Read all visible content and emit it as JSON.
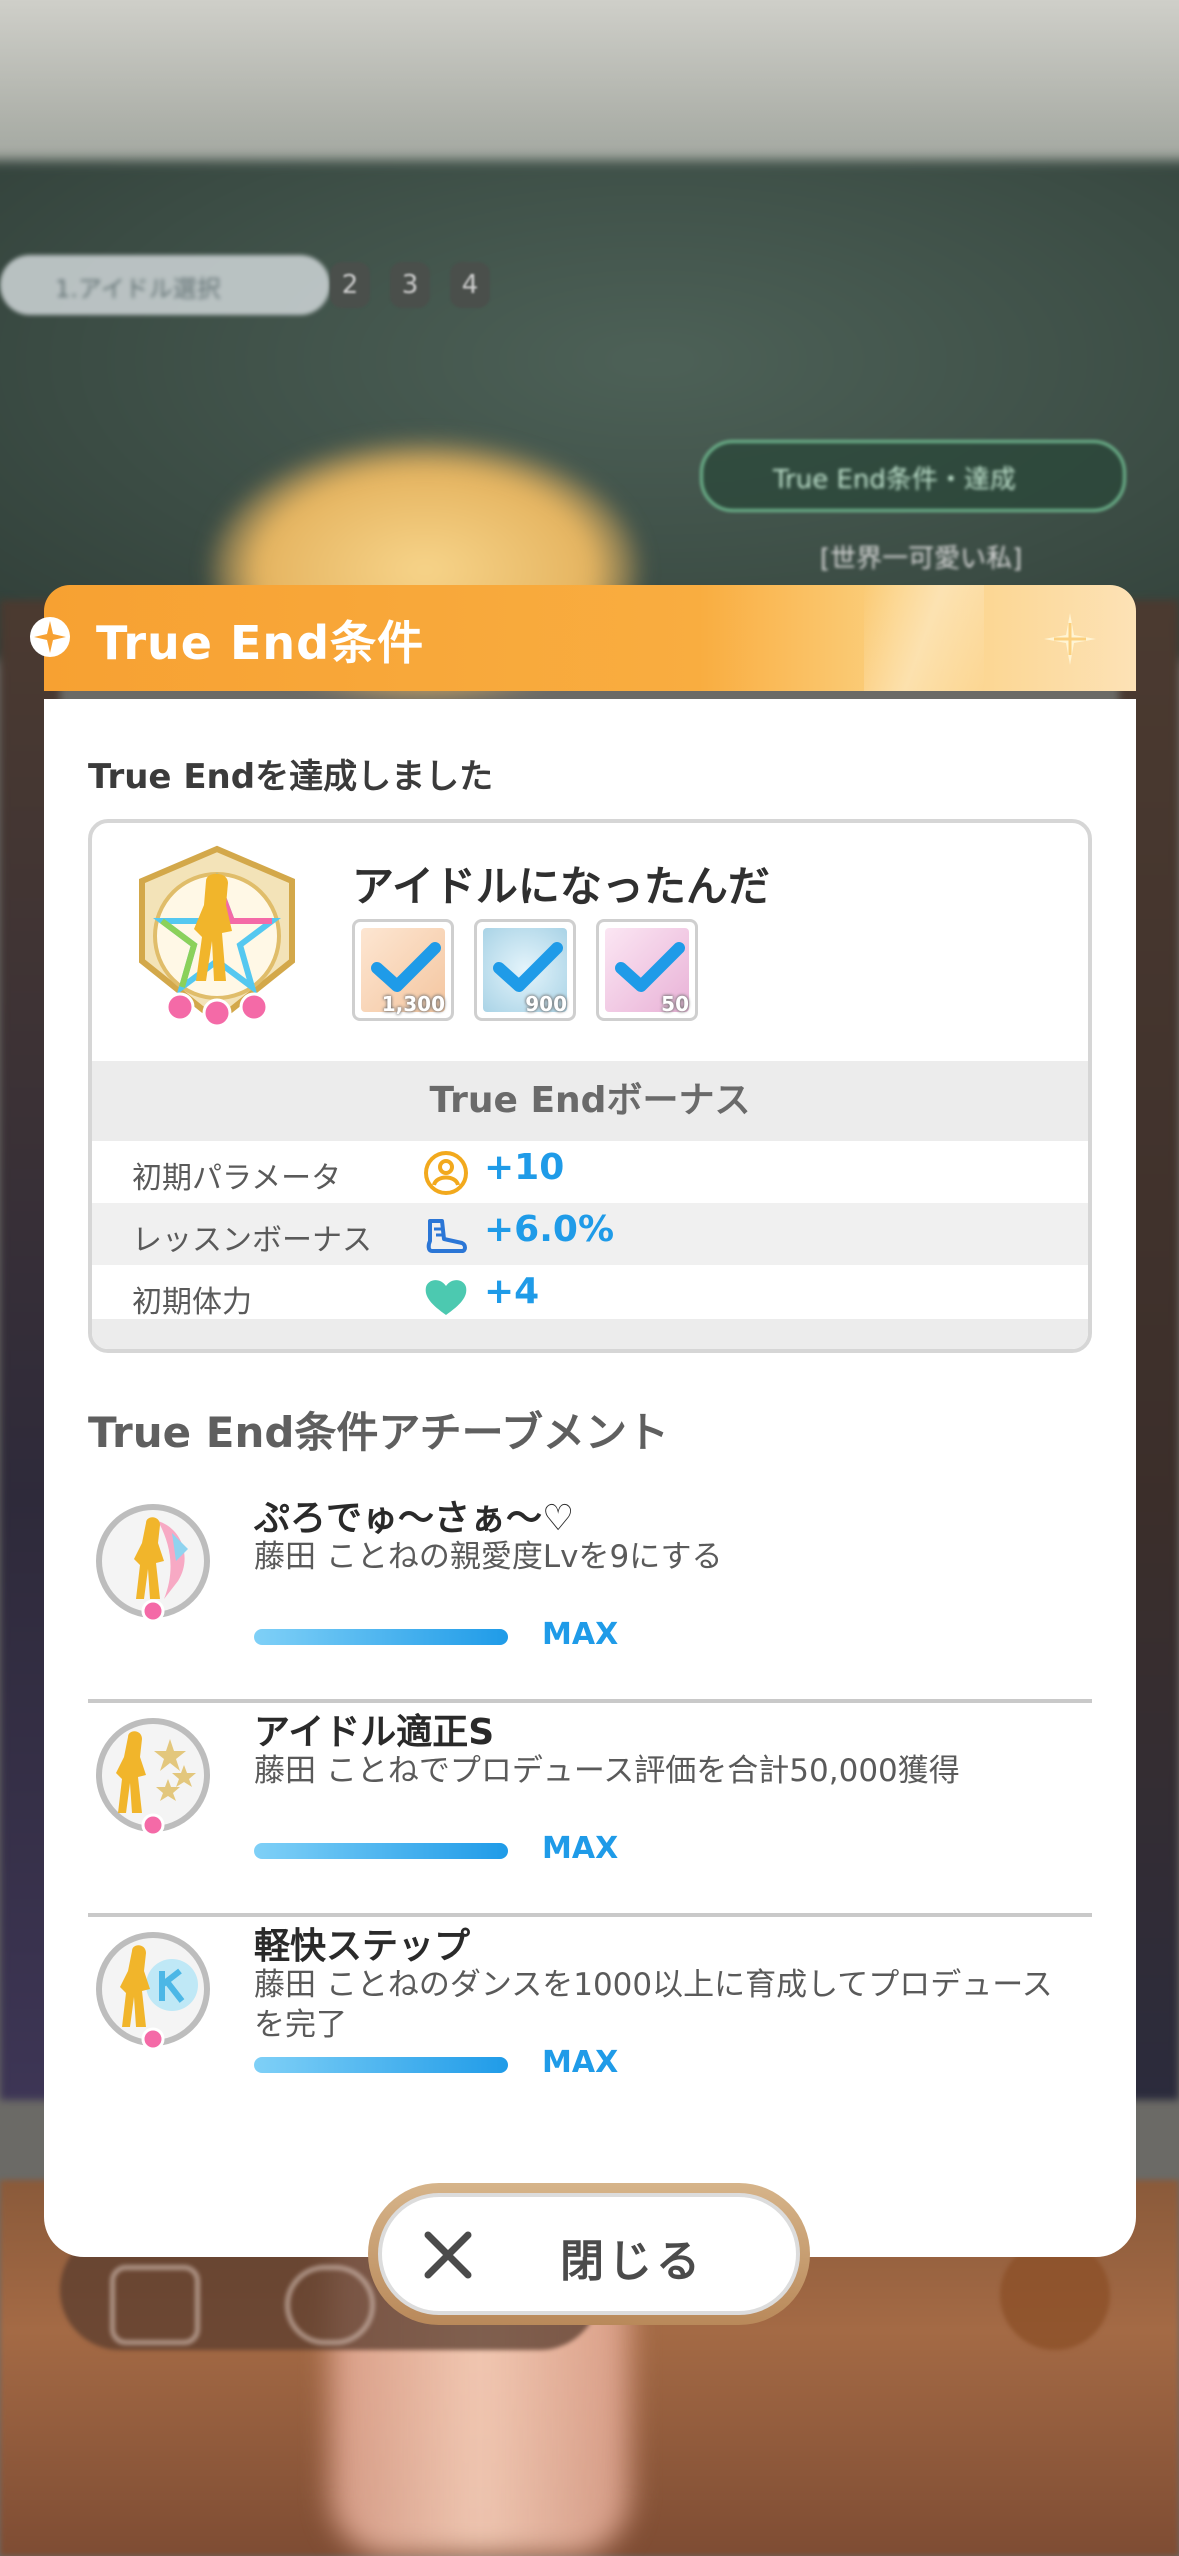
{
  "background": {
    "step_label": "1.アイドル選択",
    "step_numbers": [
      "2",
      "3",
      "4"
    ],
    "true_end_pill": "True End条件・達成",
    "subtitle": "[世界一可愛い私]"
  },
  "dialog": {
    "title": "True End条件",
    "achieved_label": "True Endを達成しました",
    "card": {
      "title": "アイドルになったんだ",
      "requirements": [
        {
          "name": "item-1",
          "count": "1,300",
          "color": "#f4c6a0"
        },
        {
          "name": "item-2",
          "count": "900",
          "color": "#a9d3e6"
        },
        {
          "name": "item-3",
          "count": "50",
          "color": "#e9b2d7"
        }
      ],
      "bonus_header": "True Endボーナス",
      "bonuses": [
        {
          "label": "初期パラメータ",
          "value": "+10",
          "icon": "parameter-icon"
        },
        {
          "label": "レッスンボーナス",
          "value": "+6.0%",
          "icon": "lesson-shoe-icon"
        },
        {
          "label": "初期体力",
          "value": "+4",
          "icon": "heart-icon"
        }
      ]
    },
    "achievements_title": "True End条件アチーブメント",
    "achievements": [
      {
        "name": "ぷろでゅ～さぁ～♡",
        "desc": "藤田 ことねの親愛度Lvを9にする",
        "status": "MAX"
      },
      {
        "name": "アイドル適正S",
        "desc": "藤田 ことねでプロデュース評価を合計50,000獲得",
        "status": "MAX"
      },
      {
        "name": "軽快ステップ",
        "desc": "藤田 ことねのダンスを1000以上に育成してプロデュースを完了",
        "status": "MAX"
      }
    ],
    "close_label": "閉じる"
  },
  "colors": {
    "header_orange": "#f7a132",
    "value_blue": "#1f9be8",
    "progress_fill": 1.0
  }
}
